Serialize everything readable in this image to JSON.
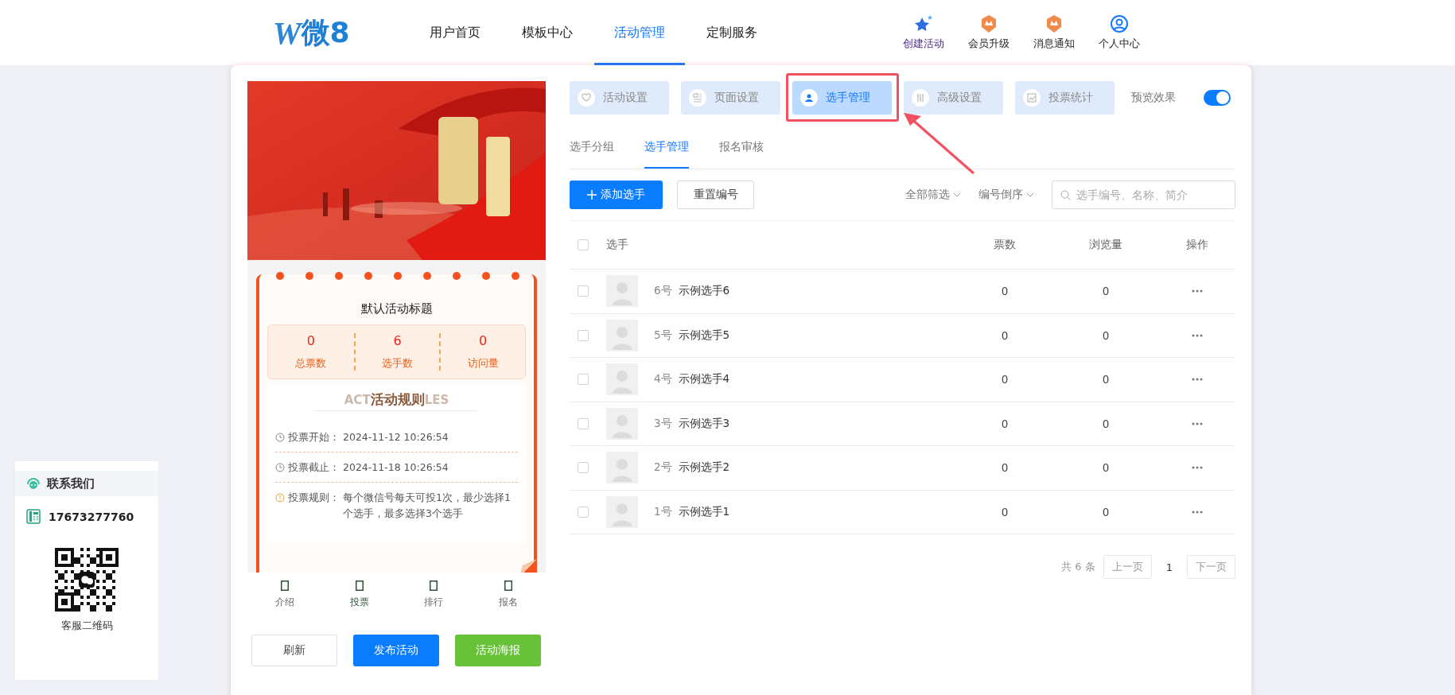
{
  "header": {
    "logo": {
      "letter": "W",
      "text": "微8"
    },
    "nav": [
      {
        "label": "用户首页",
        "selected": false
      },
      {
        "label": "模板中心",
        "selected": false
      },
      {
        "label": "活动管理",
        "selected": true
      },
      {
        "label": "定制服务",
        "selected": false
      }
    ],
    "actions": [
      {
        "label": "创建活动",
        "kind": "star"
      },
      {
        "label": "会员升级",
        "kind": "badge"
      },
      {
        "label": "消息通知",
        "kind": "badge"
      },
      {
        "label": "个人中心",
        "kind": "user"
      }
    ]
  },
  "preview": {
    "banner": {
      "kind": "picture"
    },
    "title": "默认活动标题",
    "stats": [
      {
        "value": "0",
        "label": "总票数"
      },
      {
        "value": "6",
        "label": "选手数"
      },
      {
        "value": "0",
        "label": "访问量"
      }
    ],
    "rules_title": "活动规则",
    "rules_backdrop": [
      "ACT",
      "LES"
    ],
    "rules": [
      {
        "kind": "time",
        "label": "投票开始：",
        "value": "2024-11-12 10:26:54"
      },
      {
        "kind": "time",
        "label": "投票截止：",
        "value": "2024-11-18 10:26:54"
      },
      {
        "kind": "info",
        "label": "投票规则：",
        "value": "每个微信号每天可投1次，最少选择1个选手，最多选择3个选手"
      }
    ],
    "bottom_nav": [
      {
        "label": "介绍",
        "selected": false
      },
      {
        "label": "投票",
        "selected": true
      },
      {
        "label": "排行",
        "selected": false
      },
      {
        "label": "报名",
        "selected": false
      }
    ],
    "buttons": [
      {
        "label": "刷新",
        "kind": "default"
      },
      {
        "label": "发布活动",
        "kind": "primary"
      },
      {
        "label": "活动海报",
        "kind": "success"
      }
    ]
  },
  "settings_tabs": [
    {
      "label": "活动设置",
      "kind": "heart",
      "selected": false
    },
    {
      "label": "页面设置",
      "kind": "layout",
      "selected": false
    },
    {
      "label": "选手管理",
      "kind": "user",
      "selected": true
    },
    {
      "label": "高级设置",
      "kind": "sliders",
      "selected": false
    },
    {
      "label": "投票统计",
      "kind": "chart",
      "selected": false
    }
  ],
  "preview_toggle": {
    "label": "预览效果",
    "on": true
  },
  "sub_tabs": [
    {
      "label": "选手分组",
      "selected": false
    },
    {
      "label": "选手管理",
      "selected": true
    },
    {
      "label": "报名审核",
      "selected": false
    }
  ],
  "toolbar": {
    "add_button": "添加选手",
    "reset_button": "重置编号",
    "filters": [
      "全部筛选",
      "编号倒序"
    ],
    "search": {
      "placeholder": "选手编号、名称、简介"
    }
  },
  "table": {
    "select_all": false,
    "columns": [
      "选手",
      "票数",
      "浏览量",
      "操作"
    ],
    "rows": [
      {
        "checked": false,
        "number": "6号",
        "name": "示例选手6",
        "votes": "0",
        "views": "0"
      },
      {
        "checked": false,
        "number": "5号",
        "name": "示例选手5",
        "votes": "0",
        "views": "0"
      },
      {
        "checked": false,
        "number": "4号",
        "name": "示例选手4",
        "votes": "0",
        "views": "0"
      },
      {
        "checked": false,
        "number": "3号",
        "name": "示例选手3",
        "votes": "0",
        "views": "0"
      },
      {
        "checked": false,
        "number": "2号",
        "name": "示例选手2",
        "votes": "0",
        "views": "0"
      },
      {
        "checked": false,
        "number": "1号",
        "name": "示例选手1",
        "votes": "0",
        "views": "0"
      }
    ]
  },
  "pagination": {
    "total": "共 6 条",
    "prev": "上一页",
    "page": "1",
    "next": "下一页"
  },
  "contact": {
    "title": "联系我们",
    "phone": "17673277760",
    "qr_caption": "客服二维码"
  }
}
